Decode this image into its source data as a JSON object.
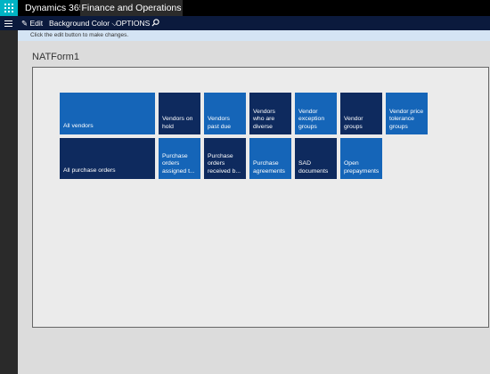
{
  "topbar": {
    "app_name": "Dynamics 365",
    "module": "Finance and Operations"
  },
  "actionbar": {
    "edit": "Edit",
    "background_color": "Background Color",
    "options": "OPTIONS"
  },
  "message": "Click the edit button to make changes.",
  "page_title": "NATForm1",
  "colors": {
    "dark_tile": "#0e2a5e",
    "blue_tile": "#1565b8",
    "accent": "#00b4c5"
  },
  "tiles": [
    {
      "label": "All vendors"
    },
    {
      "label": "Vendors on hold"
    },
    {
      "label": "Vendors past due"
    },
    {
      "label": "Vendors who are diverse"
    },
    {
      "label": "Vendor exception groups"
    },
    {
      "label": "Vendor groups"
    },
    {
      "label": "Vendor price tolerance groups"
    },
    {
      "label": "All purchase orders"
    },
    {
      "label": "Purchase orders assigned t..."
    },
    {
      "label": "Purchase orders received b..."
    },
    {
      "label": "Purchase agreements"
    },
    {
      "label": "SAD documents"
    },
    {
      "label": "Open prepayments"
    }
  ]
}
